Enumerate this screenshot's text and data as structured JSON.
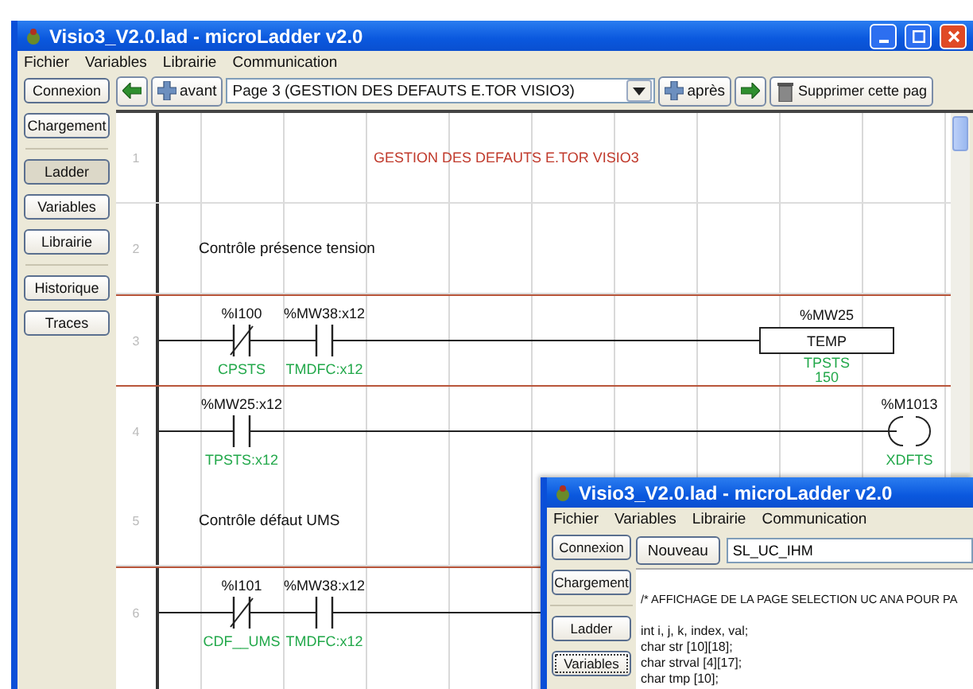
{
  "main_window": {
    "title": "Visio3_V2.0.lad - microLadder v2.0",
    "menu": [
      "Fichier",
      "Variables",
      "Librairie",
      "Communication"
    ],
    "sidebar_groups": [
      {
        "buttons": [
          {
            "label": "Connexion",
            "selected": false
          },
          {
            "label": "Chargement",
            "selected": false
          }
        ]
      },
      {
        "buttons": [
          {
            "label": "Ladder",
            "selected": true
          },
          {
            "label": "Variables",
            "selected": false
          },
          {
            "label": "Librairie",
            "selected": false
          }
        ]
      },
      {
        "buttons": [
          {
            "label": "Historique",
            "selected": false
          },
          {
            "label": "Traces",
            "selected": false
          }
        ]
      }
    ],
    "toolbar": {
      "insert_before": "avant",
      "page_selector": "Page 3 (GESTION DES DEFAUTS E.TOR VISIO3)",
      "insert_after": "après",
      "delete": "Supprimer cette pag"
    },
    "rows": [
      {
        "number": "1",
        "kind": "title",
        "text": "GESTION DES DEFAUTS E.TOR VISIO3"
      },
      {
        "number": "2",
        "kind": "comment",
        "text": "Contrôle présence tension"
      },
      {
        "number": "3",
        "kind": "rung",
        "elements": [
          {
            "kind": "nc",
            "address": "%I100",
            "symbol": "CPSTS"
          },
          {
            "kind": "no",
            "address": "%MW38:x12",
            "symbol": "TMDFC:x12"
          },
          {
            "kind": "block",
            "address": "%MW25",
            "name": "TEMP",
            "symbol": "TPSTS",
            "value": "150"
          }
        ]
      },
      {
        "number": "4",
        "kind": "rung",
        "elements": [
          {
            "kind": "no",
            "address": "%MW25:x12",
            "symbol": "TPSTS:x12"
          },
          {
            "kind": "coil",
            "address": "%M1013",
            "symbol": "XDFTS"
          }
        ]
      },
      {
        "number": "5",
        "kind": "comment",
        "text": "Contrôle défaut UMS"
      },
      {
        "number": "6",
        "kind": "rung",
        "elements": [
          {
            "kind": "nc",
            "address": "%I101",
            "symbol": "CDF__UMS"
          },
          {
            "kind": "no",
            "address": "%MW38:x12",
            "symbol": "TMDFC:x12"
          }
        ]
      }
    ]
  },
  "second_window": {
    "title": "Visio3_V2.0.lad - microLadder v2.0",
    "menu": [
      "Fichier",
      "Variables",
      "Librairie",
      "Communication"
    ],
    "sidebar_groups": [
      {
        "buttons": [
          {
            "label": "Connexion",
            "selected": false
          },
          {
            "label": "Chargement",
            "selected": false
          }
        ]
      },
      {
        "buttons": [
          {
            "label": "Ladder",
            "selected": false
          },
          {
            "label": "Variables",
            "selected": true
          }
        ]
      }
    ],
    "new_button": "Nouveau",
    "name_field": "SL_UC_IHM",
    "code_comment": "/* AFFICHAGE DE LA PAGE SELECTION UC ANA POUR PA",
    "code_lines": [
      "int i, j, k, index, val;",
      "char str [10][18];",
      "char strval [4][17];",
      "char tmp [10];"
    ]
  }
}
